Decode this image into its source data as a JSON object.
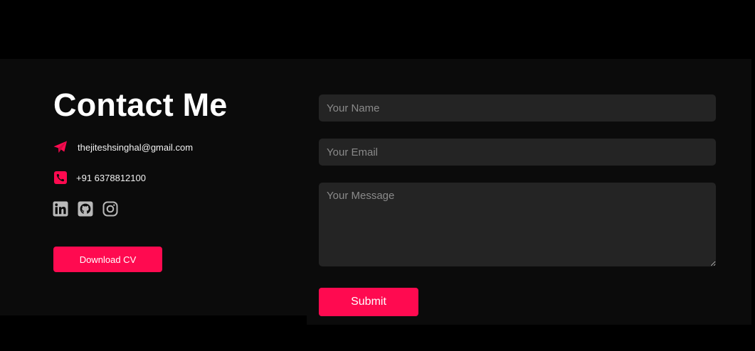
{
  "contact": {
    "title": "Contact Me",
    "email": "thejiteshsinghal@gmail.com",
    "phone": "+91 6378812100",
    "email_icon": "paper-plane-icon",
    "phone_icon": "phone-icon",
    "socials": [
      "linkedin-icon",
      "github-icon",
      "instagram-icon"
    ],
    "download_label": "Download CV"
  },
  "form": {
    "name_placeholder": "Your Name",
    "email_placeholder": "Your Email",
    "message_placeholder": "Your Message",
    "submit_label": "Submit"
  },
  "colors": {
    "accent": "#ff0a50",
    "background": "#0b0b0b",
    "field": "#242424"
  }
}
